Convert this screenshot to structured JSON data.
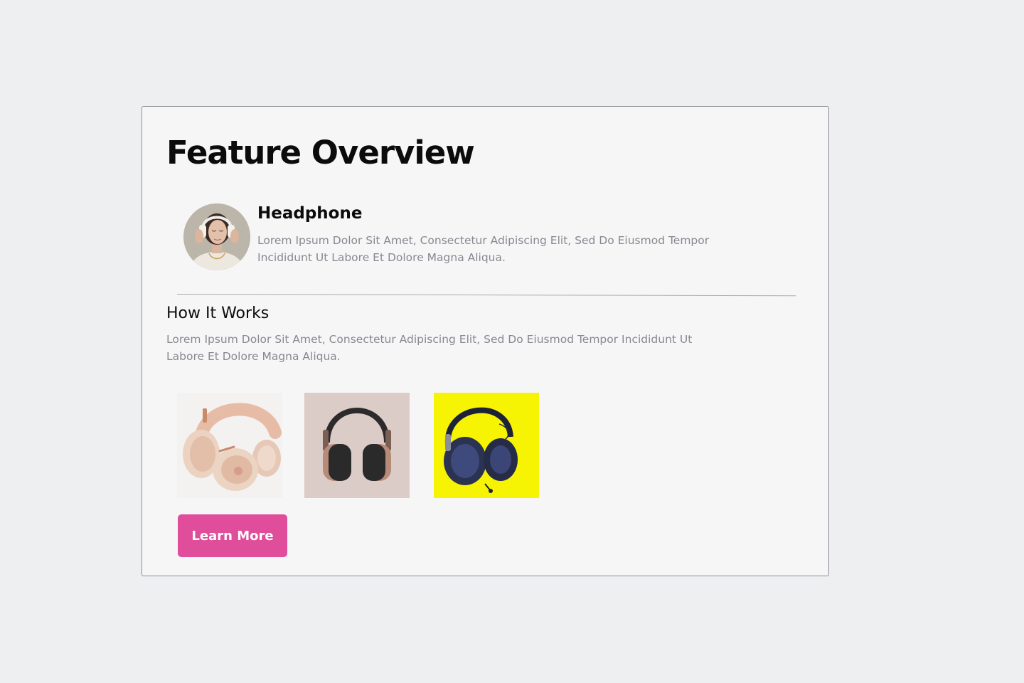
{
  "card": {
    "title": "Feature Overview"
  },
  "feature": {
    "avatar_icon": "person-wearing-headphones-photo",
    "title": "Headphone",
    "description": "Lorem Ipsum Dolor Sit Amet, Consectetur Adipiscing Elit, Sed Do Eiusmod Tempor Incididunt Ut Labore Et Dolore Magna Aliqua."
  },
  "how_it_works": {
    "title": "How It Works",
    "description": "Lorem Ipsum Dolor Sit Amet, Consectetur Adipiscing Elit, Sed Do Eiusmod Tempor Incididunt Ut Labore Et Dolore Magna Aliqua."
  },
  "gallery": [
    {
      "icon": "rose-gold-headphones-photo",
      "background": "#f4f2f1"
    },
    {
      "icon": "black-headphones-pink-background-photo",
      "background": "#dcccc7"
    },
    {
      "icon": "blue-headphones-yellow-background-photo",
      "background": "#f6f303"
    }
  ],
  "cta": {
    "label": "Learn More",
    "color": "#e04d9b"
  },
  "colors": {
    "page_background": "#eeeff1",
    "card_background": "#f7f6f7",
    "heading": "#0b0b0b",
    "body_text": "#8a8790"
  }
}
